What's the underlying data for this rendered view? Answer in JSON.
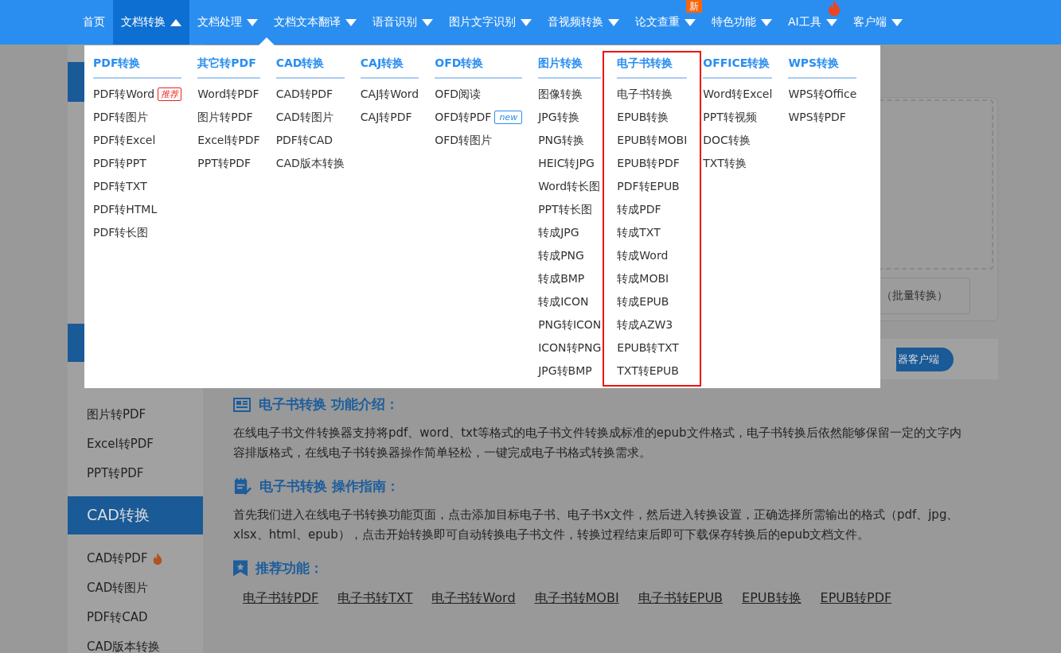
{
  "nav": [
    {
      "label": "首页",
      "selected": false,
      "has_menu": false
    },
    {
      "label": "文档转换",
      "selected": true,
      "has_menu": true
    },
    {
      "label": "文档处理",
      "selected": false,
      "has_menu": true
    },
    {
      "label": "文档文本翻译",
      "selected": false,
      "has_menu": true
    },
    {
      "label": "语音识别",
      "selected": false,
      "has_menu": true
    },
    {
      "label": "图片文字识别",
      "selected": false,
      "has_menu": true
    },
    {
      "label": "音视频转换",
      "selected": false,
      "has_menu": true
    },
    {
      "label": "论文查重",
      "selected": false,
      "has_menu": true,
      "badge": "新"
    },
    {
      "label": "特色功能",
      "selected": false,
      "has_menu": true
    },
    {
      "label": "AI工具",
      "selected": false,
      "has_menu": true,
      "hot": true
    },
    {
      "label": "客户端",
      "selected": false,
      "has_menu": true
    }
  ],
  "dropdown": {
    "columns": [
      {
        "heading": "PDF转换",
        "highlighted": false,
        "items": [
          {
            "label": "PDF转Word",
            "badge": {
              "text": "推荐",
              "kind": "recommend"
            }
          },
          {
            "label": "PDF转图片"
          },
          {
            "label": "PDF转Excel"
          },
          {
            "label": "PDF转PPT"
          },
          {
            "label": "PDF转TXT"
          },
          {
            "label": "PDF转HTML"
          },
          {
            "label": "PDF转长图"
          }
        ]
      },
      {
        "heading": "其它转PDF",
        "highlighted": false,
        "items": [
          {
            "label": "Word转PDF"
          },
          {
            "label": "图片转PDF"
          },
          {
            "label": "Excel转PDF"
          },
          {
            "label": "PPT转PDF"
          }
        ]
      },
      {
        "heading": "CAD转换",
        "highlighted": false,
        "items": [
          {
            "label": "CAD转PDF"
          },
          {
            "label": "CAD转图片"
          },
          {
            "label": "PDF转CAD"
          },
          {
            "label": "CAD版本转换"
          }
        ]
      },
      {
        "heading": "CAJ转换",
        "highlighted": false,
        "items": [
          {
            "label": "CAJ转Word"
          },
          {
            "label": "CAJ转PDF"
          }
        ]
      },
      {
        "heading": "OFD转换",
        "highlighted": false,
        "items": [
          {
            "label": "OFD阅读"
          },
          {
            "label": "OFD转PDF",
            "badge": {
              "text": "new",
              "kind": "new"
            }
          },
          {
            "label": "OFD转图片"
          }
        ]
      },
      {
        "heading": "图片转换",
        "highlighted": false,
        "items": [
          {
            "label": "图像转换"
          },
          {
            "label": "JPG转换"
          },
          {
            "label": "PNG转换"
          },
          {
            "label": "HEIC转JPG"
          },
          {
            "label": "Word转长图"
          },
          {
            "label": "PPT转长图"
          },
          {
            "label": "转成JPG"
          },
          {
            "label": "转成PNG"
          },
          {
            "label": "转成BMP"
          },
          {
            "label": "转成ICON"
          },
          {
            "label": "PNG转ICON"
          },
          {
            "label": "ICON转PNG"
          },
          {
            "label": "JPG转BMP"
          }
        ]
      },
      {
        "heading": "电子书转换",
        "highlighted": true,
        "items": [
          {
            "label": "电子书转换"
          },
          {
            "label": "EPUB转换"
          },
          {
            "label": "EPUB转MOBI"
          },
          {
            "label": "EPUB转PDF"
          },
          {
            "label": "PDF转EPUB"
          },
          {
            "label": "转成PDF"
          },
          {
            "label": "转成TXT"
          },
          {
            "label": "转成Word"
          },
          {
            "label": "转成MOBI"
          },
          {
            "label": "转成EPUB"
          },
          {
            "label": "转成AZW3"
          },
          {
            "label": "EPUB转TXT"
          },
          {
            "label": "TXT转EPUB"
          }
        ]
      },
      {
        "heading": "OFFICE转换",
        "highlighted": false,
        "items": [
          {
            "label": "Word转Excel"
          },
          {
            "label": "PPT转视频"
          },
          {
            "label": "DOC转换"
          },
          {
            "label": "TXT转换"
          }
        ]
      },
      {
        "heading": "WPS转换",
        "highlighted": false,
        "items": [
          {
            "label": "WPS转Office"
          },
          {
            "label": "WPS转PDF"
          }
        ]
      }
    ]
  },
  "sidebar": {
    "items": [
      {
        "kind": "link",
        "label": "图片转PDF",
        "hot": false
      },
      {
        "kind": "link",
        "label": "Excel转PDF",
        "hot": false
      },
      {
        "kind": "link",
        "label": "PPT转PDF",
        "hot": false
      },
      {
        "kind": "header",
        "label": "CAD转换"
      },
      {
        "kind": "link",
        "label": "CAD转PDF",
        "hot": true
      },
      {
        "kind": "link",
        "label": "CAD转图片",
        "hot": false
      },
      {
        "kind": "link",
        "label": "PDF转CAD",
        "hot": false
      },
      {
        "kind": "link",
        "label": "CAD版本转换",
        "hot": false
      }
    ]
  },
  "upload": {
    "batch_button": "（批量转换）",
    "client_button": "器客户端"
  },
  "sections": [
    {
      "kind": "intro",
      "title": "**电子书转换** 功能介绍：",
      "text": "在线电子书文件转换器支持将pdf、word、txt等格式的电子书文件转换成标准的epub文件格式，电子书转换后依然能够保留一定的文字内容排版格式，在线电子书转换器操作简单轻松，一键完成电子书格式转换需求。"
    },
    {
      "kind": "guide",
      "title": "**电子书转换** 操作指南：",
      "text": "首先我们进入在线电子书转换功能页面，点击添加目标电子书、电子书x文件，然后进入转换设置，正确选择所需输出的格式（pdf、jpg、xlsx、html、epub），点击开始转换即可自动转换电子书文件，转换过程结束后即可下载保存转换后的epub文档文件。"
    },
    {
      "kind": "recommend",
      "title": "推荐功能：",
      "links": [
        "电子书转PDF",
        "电子书转TXT",
        "电子书转Word",
        "电子书转MOBI",
        "电子书转EPUB",
        "EPUB转换",
        "EPUB转PDF"
      ]
    }
  ]
}
